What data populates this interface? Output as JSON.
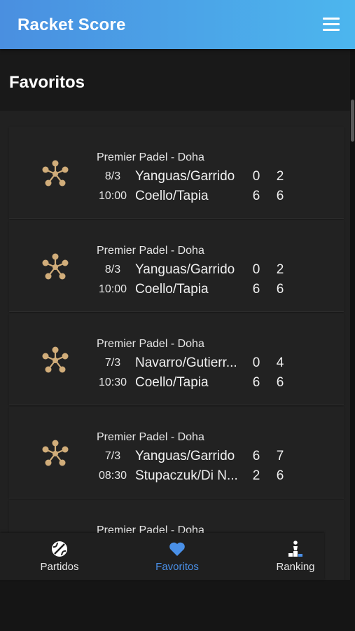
{
  "app": {
    "title": "Racket Score"
  },
  "section": {
    "title": "Favoritos"
  },
  "matches": [
    {
      "tournament": "Premier Padel - Doha",
      "date": "8/3",
      "time": "10:00",
      "team1": "Yanguas/Garrido",
      "team2": "Coello/Tapia",
      "team1_scores": [
        "0",
        "2"
      ],
      "team2_scores": [
        "6",
        "6"
      ]
    },
    {
      "tournament": "Premier Padel - Doha",
      "date": "8/3",
      "time": "10:00",
      "team1": "Yanguas/Garrido",
      "team2": "Coello/Tapia",
      "team1_scores": [
        "0",
        "2"
      ],
      "team2_scores": [
        "6",
        "6"
      ]
    },
    {
      "tournament": "Premier Padel - Doha",
      "date": "7/3",
      "time": "10:30",
      "team1": "Navarro/Gutierr...",
      "team2": "Coello/Tapia",
      "team1_scores": [
        "0",
        "4"
      ],
      "team2_scores": [
        "6",
        "6"
      ]
    },
    {
      "tournament": "Premier Padel - Doha",
      "date": "7/3",
      "time": "08:30",
      "team1": "Yanguas/Garrido",
      "team2": "Stupaczuk/Di N...",
      "team1_scores": [
        "6",
        "7"
      ],
      "team2_scores": [
        "2",
        "6"
      ]
    },
    {
      "tournament": "Premier Padel - Doha"
    }
  ],
  "nav": {
    "items": [
      {
        "label": "Partidos",
        "icon": "tennis-ball-icon"
      },
      {
        "label": "Favoritos",
        "icon": "heart-icon",
        "active": true
      },
      {
        "label": "Ranking",
        "icon": "podium-icon"
      }
    ]
  },
  "colors": {
    "accent": "#4a90e8",
    "icon_gold": "#d1ad7a",
    "appbar_start": "#4a8fe0",
    "appbar_end": "#4cb6ee"
  }
}
